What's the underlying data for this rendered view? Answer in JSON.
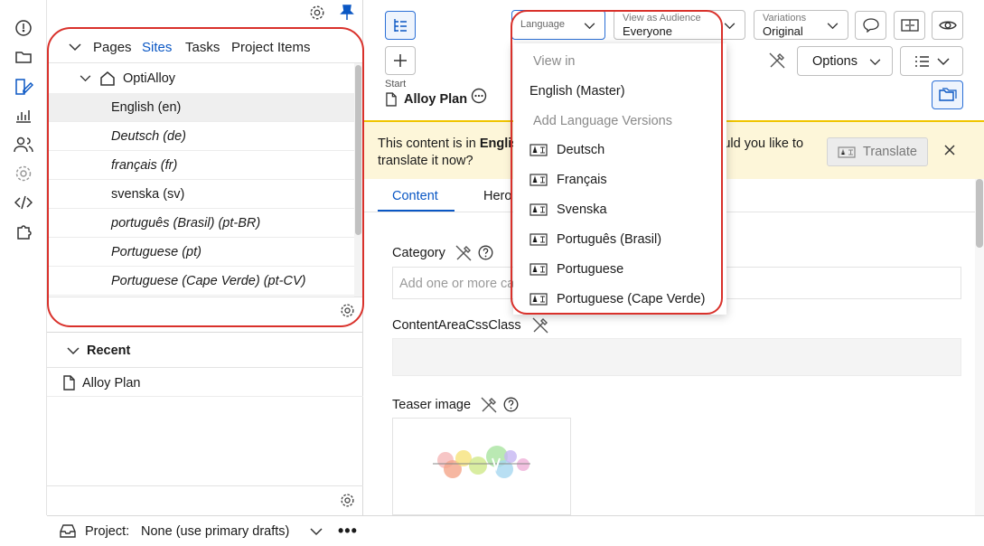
{
  "nav": {
    "tabs": [
      "Pages",
      "Sites",
      "Tasks",
      "Project Items"
    ],
    "active_tab": "Sites",
    "root": "OptiAlloy",
    "languages": [
      {
        "label": "English (en)",
        "italic": false,
        "selected": true
      },
      {
        "label": "Deutsch (de)",
        "italic": true,
        "selected": false
      },
      {
        "label": "français (fr)",
        "italic": true,
        "selected": false
      },
      {
        "label": "svenska (sv)",
        "italic": false,
        "selected": false
      },
      {
        "label": "português (Brasil) (pt-BR)",
        "italic": true,
        "selected": false
      },
      {
        "label": "Portuguese (pt)",
        "italic": true,
        "selected": false
      },
      {
        "label": "Portuguese (Cape Verde) (pt-CV)",
        "italic": true,
        "selected": false
      }
    ],
    "recent_title": "Recent",
    "recent_items": [
      "Alloy Plan"
    ]
  },
  "bottom": {
    "project_label": "Project:",
    "project_value": "None (use primary drafts)"
  },
  "header": {
    "start_label": "Start",
    "page_title": "Alloy Plan",
    "language_label": "Language",
    "audience_label": "View as Audience",
    "audience_value": "Everyone",
    "variations_label": "Variations",
    "variations_value": "Original",
    "options_label": "Options"
  },
  "banner": {
    "line1_start": "This content is in ",
    "line1_bold": "Englis",
    "line1_end": "uld you like to",
    "line2": "translate it now?",
    "translate_label": "Translate"
  },
  "content_tabs": [
    "Content",
    "Hero"
  ],
  "fields": {
    "category_label": "Category",
    "category_placeholder": "Add one or more ca",
    "css_label": "ContentAreaCssClass",
    "teaser_label": "Teaser image"
  },
  "dropdown": {
    "view_in_heading": "View in",
    "master": "English (Master)",
    "add_heading": "Add Language Versions",
    "languages": [
      "Deutsch",
      "Français",
      "Svenska",
      "Português (Brasil)",
      "Portuguese",
      "Portuguese (Cape Verde)"
    ]
  },
  "colors": {
    "accent": "#0a57c4",
    "highlight_ring": "#d9312b",
    "banner_bg": "#fdf6d9",
    "banner_border": "#f0c400"
  }
}
